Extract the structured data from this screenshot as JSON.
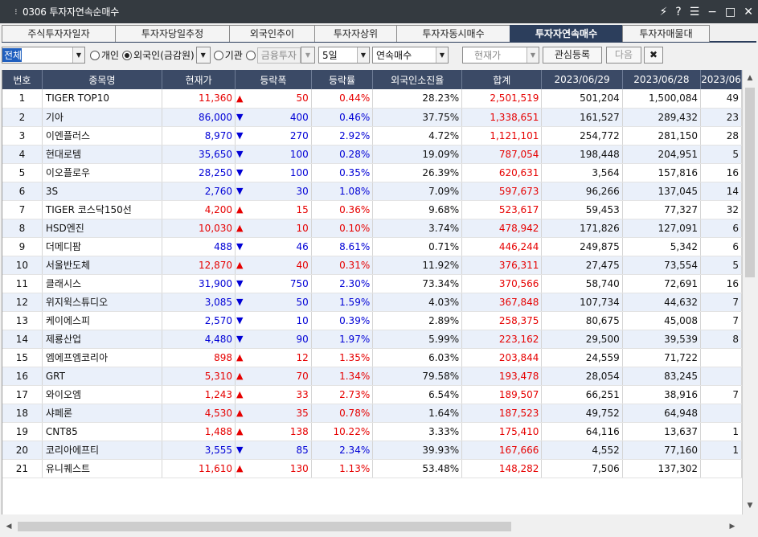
{
  "window": {
    "title": "0306 투자자연속순매수",
    "controls": [
      "⚡",
      "?",
      "☰",
      "−",
      "□",
      "✕"
    ]
  },
  "tabs": [
    {
      "label": "주식투자자일자",
      "active": false
    },
    {
      "label": "투자자당일추정",
      "active": false
    },
    {
      "label": "외국인추이",
      "active": false
    },
    {
      "label": "투자자상위",
      "active": false
    },
    {
      "label": "투자자동시매수",
      "active": false
    },
    {
      "label": "투자자연속매수",
      "active": true
    },
    {
      "label": "투자자매물대",
      "active": false
    }
  ],
  "filters": {
    "market": "전체",
    "radio_individual": "개인",
    "radio_foreign": "외국인(금감원)",
    "radio_institution": "기관",
    "radio_finance": "금융투자",
    "period": "5일",
    "mode": "연속매수",
    "price_button": "현재가",
    "watch_button": "관심등록",
    "next_button": "다음",
    "close_icon": "✖"
  },
  "table": {
    "headers": [
      "번호",
      "종목명",
      "현재가",
      "등락폭",
      "등락률",
      "외국인소진율",
      "합계",
      "2023/06/29",
      "2023/06/28",
      "2023/06"
    ],
    "rows": [
      {
        "no": "1",
        "name": "TIGER TOP10",
        "price": "11,360",
        "dir": "up",
        "change": "50",
        "rate": "0.44%",
        "foreign": "28.23%",
        "total": "2,501,519",
        "d1": "501,204",
        "d2": "1,500,084",
        "d3": "49"
      },
      {
        "no": "2",
        "name": "기아",
        "price": "86,000",
        "dir": "down",
        "change": "400",
        "rate": "0.46%",
        "foreign": "37.75%",
        "total": "1,338,651",
        "d1": "161,527",
        "d2": "289,432",
        "d3": "23"
      },
      {
        "no": "3",
        "name": "이엔플러스",
        "price": "8,970",
        "dir": "down",
        "change": "270",
        "rate": "2.92%",
        "foreign": "4.72%",
        "total": "1,121,101",
        "d1": "254,772",
        "d2": "281,150",
        "d3": "28"
      },
      {
        "no": "4",
        "name": "현대로템",
        "price": "35,650",
        "dir": "down",
        "change": "100",
        "rate": "0.28%",
        "foreign": "19.09%",
        "total": "787,054",
        "d1": "198,448",
        "d2": "204,951",
        "d3": "5"
      },
      {
        "no": "5",
        "name": "이오플로우",
        "price": "28,250",
        "dir": "down",
        "change": "100",
        "rate": "0.35%",
        "foreign": "26.39%",
        "total": "620,631",
        "d1": "3,564",
        "d2": "157,816",
        "d3": "16"
      },
      {
        "no": "6",
        "name": "3S",
        "price": "2,760",
        "dir": "down",
        "change": "30",
        "rate": "1.08%",
        "foreign": "7.09%",
        "total": "597,673",
        "d1": "96,266",
        "d2": "137,045",
        "d3": "14"
      },
      {
        "no": "7",
        "name": "TIGER 코스닥150선",
        "price": "4,200",
        "dir": "up",
        "change": "15",
        "rate": "0.36%",
        "foreign": "9.68%",
        "total": "523,617",
        "d1": "59,453",
        "d2": "77,327",
        "d3": "32"
      },
      {
        "no": "8",
        "name": "HSD엔진",
        "price": "10,030",
        "dir": "up",
        "change": "10",
        "rate": "0.10%",
        "foreign": "3.74%",
        "total": "478,942",
        "d1": "171,826",
        "d2": "127,091",
        "d3": "6"
      },
      {
        "no": "9",
        "name": "더메디팜",
        "price": "488",
        "dir": "down",
        "change": "46",
        "rate": "8.61%",
        "foreign": "0.71%",
        "total": "446,244",
        "d1": "249,875",
        "d2": "5,342",
        "d3": "6"
      },
      {
        "no": "10",
        "name": "서울반도체",
        "price": "12,870",
        "dir": "up",
        "change": "40",
        "rate": "0.31%",
        "foreign": "11.92%",
        "total": "376,311",
        "d1": "27,475",
        "d2": "73,554",
        "d3": "5"
      },
      {
        "no": "11",
        "name": "클래시스",
        "price": "31,900",
        "dir": "down",
        "change": "750",
        "rate": "2.30%",
        "foreign": "73.34%",
        "total": "370,566",
        "d1": "58,740",
        "d2": "72,691",
        "d3": "16"
      },
      {
        "no": "12",
        "name": "위지윅스튜디오",
        "price": "3,085",
        "dir": "down",
        "change": "50",
        "rate": "1.59%",
        "foreign": "4.03%",
        "total": "367,848",
        "d1": "107,734",
        "d2": "44,632",
        "d3": "7"
      },
      {
        "no": "13",
        "name": "케이에스피",
        "price": "2,570",
        "dir": "down",
        "change": "10",
        "rate": "0.39%",
        "foreign": "2.89%",
        "total": "258,375",
        "d1": "80,675",
        "d2": "45,008",
        "d3": "7"
      },
      {
        "no": "14",
        "name": "제룡산업",
        "price": "4,480",
        "dir": "down",
        "change": "90",
        "rate": "1.97%",
        "foreign": "5.99%",
        "total": "223,162",
        "d1": "29,500",
        "d2": "39,539",
        "d3": "8"
      },
      {
        "no": "15",
        "name": "엠에프엠코리아",
        "price": "898",
        "dir": "up",
        "change": "12",
        "rate": "1.35%",
        "foreign": "6.03%",
        "total": "203,844",
        "d1": "24,559",
        "d2": "71,722",
        "d3": ""
      },
      {
        "no": "16",
        "name": "GRT",
        "price": "5,310",
        "dir": "up",
        "change": "70",
        "rate": "1.34%",
        "foreign": "79.58%",
        "total": "193,478",
        "d1": "28,054",
        "d2": "83,245",
        "d3": ""
      },
      {
        "no": "17",
        "name": "와이오엠",
        "price": "1,243",
        "dir": "up",
        "change": "33",
        "rate": "2.73%",
        "foreign": "6.54%",
        "total": "189,507",
        "d1": "66,251",
        "d2": "38,916",
        "d3": "7"
      },
      {
        "no": "18",
        "name": "샤페론",
        "price": "4,530",
        "dir": "up",
        "change": "35",
        "rate": "0.78%",
        "foreign": "1.64%",
        "total": "187,523",
        "d1": "49,752",
        "d2": "64,948",
        "d3": ""
      },
      {
        "no": "19",
        "name": "CNT85",
        "price": "1,488",
        "dir": "up",
        "change": "138",
        "rate": "10.22%",
        "foreign": "3.33%",
        "total": "175,410",
        "d1": "64,116",
        "d2": "13,637",
        "d3": "1"
      },
      {
        "no": "20",
        "name": "코리아에프티",
        "price": "3,555",
        "dir": "down",
        "change": "85",
        "rate": "2.34%",
        "foreign": "39.93%",
        "total": "167,666",
        "d1": "4,552",
        "d2": "77,160",
        "d3": "1"
      },
      {
        "no": "21",
        "name": "유니퀘스트",
        "price": "11,610",
        "dir": "up",
        "change": "130",
        "rate": "1.13%",
        "foreign": "53.48%",
        "total": "148,282",
        "d1": "7,506",
        "d2": "137,302",
        "d3": ""
      }
    ]
  },
  "colors": {
    "up": "#e60000",
    "down": "#0000d6",
    "header_bg": "#3b4a66",
    "active_tab": "#2c3e5c",
    "alt_row": "#eaf0fa"
  }
}
